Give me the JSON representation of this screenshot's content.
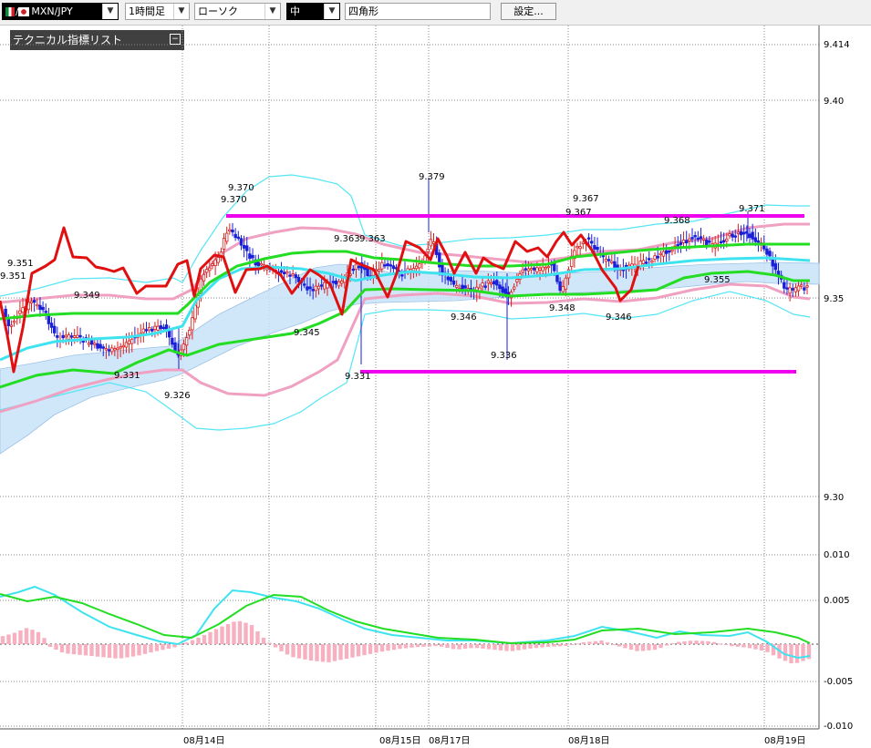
{
  "toolbar": {
    "pair": "MXN/JPY",
    "timeframe": "1時間足",
    "chart_type": "ローソク",
    "line_width": "中",
    "shape": "四角形",
    "settings_label": "設定..."
  },
  "indicator_panel": {
    "title": "テクニカル指標リスト"
  },
  "colors": {
    "up": "#d62020",
    "down": "#1a20d8",
    "bb_outer": "#55e5f5",
    "bb_inner": "#f0a0c0",
    "ma": "#22dd22",
    "ema": "#3fe3f0",
    "price_line": "#e01010",
    "box": "#ee00ee",
    "cloud": "#c8e2f8",
    "macd_hist": "#f7b0c0",
    "macd": "#3fe3f0",
    "signal": "#22dd22"
  },
  "chart_data": [
    {
      "type": "candlestick",
      "name": "MXN/JPY 1時間足",
      "x_labels": [
        "08月14日",
        "08月15日",
        "08月17日",
        "08月18日",
        "08月19日"
      ],
      "y_ticks": [
        "9.414",
        "9.40",
        "9.35",
        "9.30"
      ],
      "ylim": [
        9.2955,
        9.4235
      ],
      "grid": true,
      "annotations": [
        {
          "text": "9.351",
          "value": 9.351
        },
        {
          "text": "9.351",
          "value": 9.351
        },
        {
          "text": "9.349",
          "value": 9.349
        },
        {
          "text": "9.331",
          "value": 9.331
        },
        {
          "text": "9.326",
          "value": 9.326
        },
        {
          "text": "9.370",
          "value": 9.37
        },
        {
          "text": "9.370",
          "value": 9.37
        },
        {
          "text": "9.345",
          "value": 9.345
        },
        {
          "text": "9.363",
          "value": 9.363
        },
        {
          "text": "9.363",
          "value": 9.363
        },
        {
          "text": "9.331",
          "value": 9.331
        },
        {
          "text": "9.379",
          "value": 9.379
        },
        {
          "text": "9.346",
          "value": 9.346
        },
        {
          "text": "9.336",
          "value": 9.336
        },
        {
          "text": "9.367",
          "value": 9.367
        },
        {
          "text": "9.367",
          "value": 9.367
        },
        {
          "text": "9.348",
          "value": 9.348
        },
        {
          "text": "9.346",
          "value": 9.346
        },
        {
          "text": "9.368",
          "value": 9.368
        },
        {
          "text": "9.355",
          "value": 9.355
        },
        {
          "text": "9.371",
          "value": 9.371
        }
      ],
      "rectangle_drawing": {
        "upper": 9.3672,
        "lower": 9.3425
      }
    },
    {
      "type": "bar",
      "name": "MACD",
      "y_ticks": [
        "0.010",
        "0.005",
        "-0.005",
        "-0.010"
      ],
      "ylim": [
        -0.0103,
        0.0108
      ]
    }
  ]
}
